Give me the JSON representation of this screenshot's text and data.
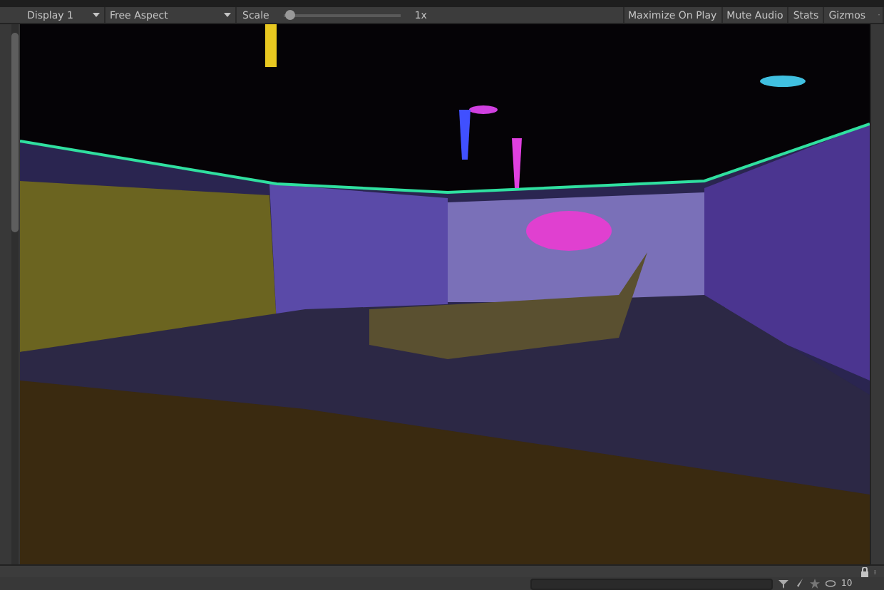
{
  "toolbar": {
    "display": "Display 1",
    "aspect": "Free Aspect",
    "scale_label": "Scale",
    "scale": {
      "level": 0.02
    },
    "scale_value": "1x",
    "buttons": [
      "Maximize On Play",
      "Mute Audio",
      "Stats",
      "Gizmos"
    ]
  },
  "bottom_bar": {
    "visible_count": "10"
  }
}
